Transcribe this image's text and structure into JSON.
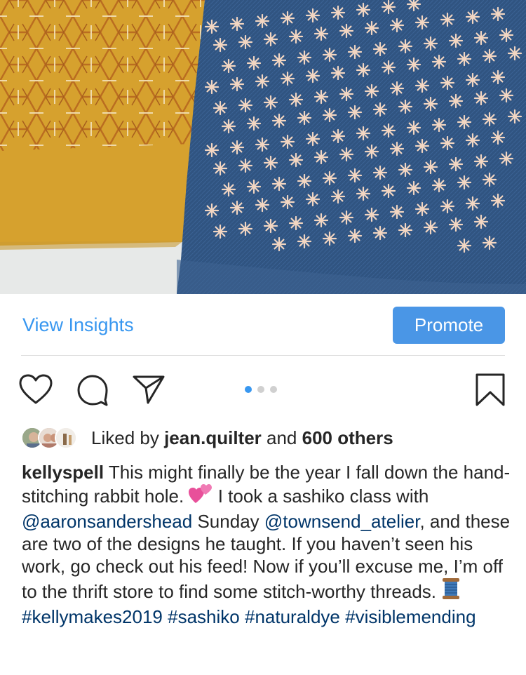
{
  "post_image": {
    "description_icon": "photo-image",
    "colors": {
      "mustard": "#d4a02c",
      "denim": "#2f4f7c",
      "stitch": "#f1d4c0",
      "table": "#e9ebea"
    }
  },
  "insights": {
    "view_insights_label": "View Insights",
    "promote_label": "Promote"
  },
  "actions": {
    "icons": [
      "heart-icon",
      "comment-icon",
      "share-icon",
      "bookmark-icon"
    ],
    "carousel_count": 3,
    "carousel_active": 1
  },
  "likes": {
    "prefix": "Liked by",
    "user": "jean.quilter",
    "middle": "and",
    "others": "600 others"
  },
  "caption": {
    "username": "kellyspell",
    "text_1": "This might finally be the year I fall down the hand-stitching rabbit hole.",
    "emoji_1": "two-hearts-emoji",
    "text_2": "I took a sashiko class with",
    "mention_1": "@aaronsandershead",
    "text_3": "Sunday",
    "mention_2": "@townsend_atelier",
    "text_4": ", and these are two of the designs he taught. If you haven’t seen his work, go check out his feed! Now if you’ll excuse me, I’m off to the thrift store to find some stitch-worthy threads.",
    "emoji_2": "spool-of-thread-emoji",
    "hashtag_1": "#kellymakes2019",
    "hashtag_2": "#sashiko",
    "hashtag_3": "#naturaldye",
    "hashtag_4": "#visiblemending"
  },
  "colors": {
    "accent": "#3897f0",
    "promote_bg": "#4a96e6",
    "link": "#003569",
    "text": "#262626"
  }
}
